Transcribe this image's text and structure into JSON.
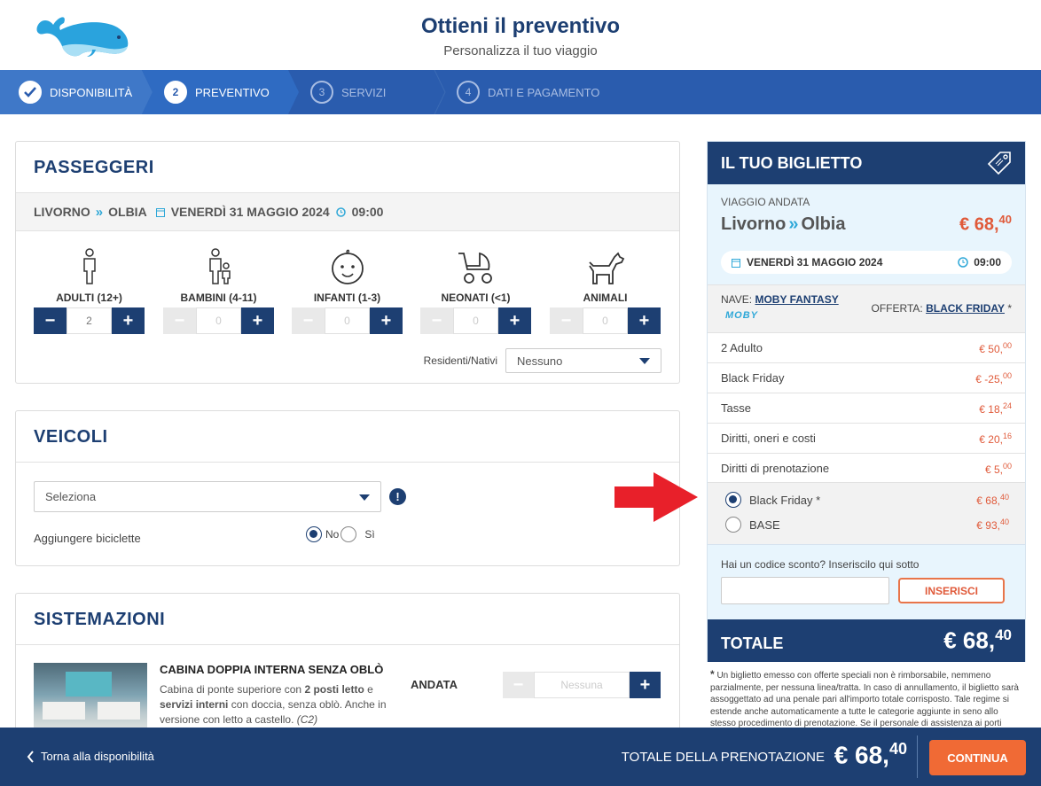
{
  "header": {
    "title": "Ottieni il preventivo",
    "subtitle": "Personalizza il tuo viaggio"
  },
  "steps": [
    {
      "num": "",
      "label": "DISPONIBILITÀ",
      "state": "done"
    },
    {
      "num": "2",
      "label": "PREVENTIVO",
      "state": "active"
    },
    {
      "num": "3",
      "label": "SERVIZI",
      "state": "todo"
    },
    {
      "num": "4",
      "label": "DATI E PAGAMENTO",
      "state": "todo"
    }
  ],
  "passengers": {
    "title": "PASSEGGERI",
    "route": {
      "from": "LIVORNO",
      "to": "OLBIA",
      "date": "VENERDÌ 31 MAGGIO 2024",
      "time": "09:00"
    },
    "types": [
      {
        "label": "ADULTI (12+)",
        "value": "2",
        "icon": "adult-icon"
      },
      {
        "label": "BAMBINI (4-11)",
        "value": "0",
        "icon": "child-icon"
      },
      {
        "label": "INFANTI (1-3)",
        "value": "0",
        "icon": "infant-face-icon"
      },
      {
        "label": "NEONATI (<1)",
        "value": "0",
        "icon": "stroller-icon"
      },
      {
        "label": "ANIMALI",
        "value": "0",
        "icon": "dog-icon"
      }
    ],
    "residents_label": "Residenti/Nativi",
    "residents_value": "Nessuno"
  },
  "vehicles": {
    "title": "VEICOLI",
    "select_value": "Seleziona",
    "bike_label": "Aggiungere biciclette",
    "no_label": "No",
    "si_label": "Sì"
  },
  "accommodation": {
    "title": "SISTEMAZIONI",
    "cabin_title": "CABINA DOPPIA INTERNA SENZA OBLÒ",
    "cabin_desc_1": "Cabina di ponte superiore con ",
    "cabin_desc_b1": "2 posti letto",
    "cabin_desc_2": " e ",
    "cabin_desc_b2": "servizi interni",
    "cabin_desc_3": " con doccia, senza oblò. Anche in versione con letto a castello. ",
    "cabin_code": "(C2)",
    "direction": "ANDATA",
    "value": "Nessuna"
  },
  "ticket": {
    "title": "IL TUO BIGLIETTO",
    "trip_label": "VIAGGIO ANDATA",
    "from": "Livorno",
    "to": "Olbia",
    "price_int": "€ 68,",
    "price_dec": "40",
    "date": "VENERDÌ 31 MAGGIO 2024",
    "time": "09:00",
    "ship_label": "NAVE:",
    "ship_name": "MOBY FANTASY",
    "brand": "MOBY",
    "offer_label": "OFFERTA:",
    "offer_name": "BLACK FRIDAY",
    "offer_mark": "*",
    "lines": [
      {
        "label": "2 Adulto",
        "int": "€ 50,",
        "dec": "00"
      },
      {
        "label": "Black Friday",
        "int": "€ -25,",
        "dec": "00"
      },
      {
        "label": "Tasse",
        "int": "€ 18,",
        "dec": "24"
      },
      {
        "label": "Diritti, oneri e costi",
        "int": "€ 20,",
        "dec": "16"
      },
      {
        "label": "Diritti di prenotazione",
        "int": "€ 5,",
        "dec": "00"
      }
    ],
    "fares": [
      {
        "label": "Black Friday *",
        "int": "€ 68,",
        "dec": "40",
        "selected": true
      },
      {
        "label": "BASE",
        "int": "€ 93,",
        "dec": "40",
        "selected": false
      }
    ],
    "promo_label": "Hai un codice sconto? Inseriscilo qui sotto",
    "promo_placeholder": "",
    "promo_button": "INSERISCI",
    "total_label": "TOTALE",
    "total_int": "€ 68,",
    "total_dec": "40",
    "note": "Un biglietto emesso con offerte speciali non è rimborsabile, nemmeno parzialmente, per nessuna linea/tratta. In caso di annullamento, il biglietto sarà assoggettato ad una penale pari all'importo totale corrisposto. Tale regime si estende anche automaticamente a tutte le categorie aggiunte in seno allo stesso procedimento di prenotazione. Se il personale di assistenza ai porti"
  },
  "footer": {
    "back_label": "Torna alla disponibilità",
    "total_label": "TOTALE DELLA PRENOTAZIONE",
    "total_int": "€ 68,",
    "total_dec": "40",
    "continue_label": "CONTINUA"
  },
  "colors": {
    "primary": "#1d3f72",
    "steps_bg": "#2a5cae",
    "accent": "#f06a35",
    "price": "#e05a3a",
    "arrow": "#e8202a"
  }
}
